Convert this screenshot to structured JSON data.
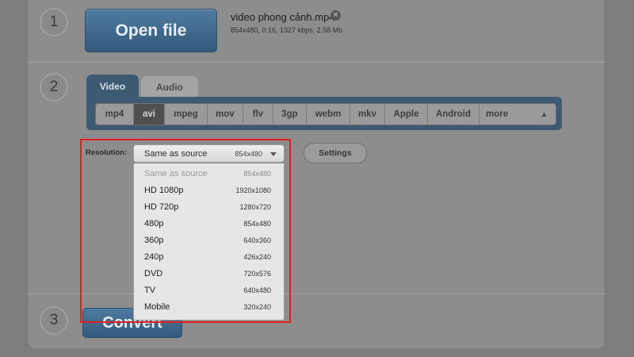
{
  "steps": {
    "one": "1",
    "two": "2",
    "three": "3"
  },
  "open_file": {
    "label": "Open file"
  },
  "file": {
    "name": "video phong cảnh.mp4",
    "meta": "854x480, 0:16, 1327 kbps, 2.58 Mb",
    "remove_icon": "close-circle-icon"
  },
  "tabs": {
    "video": "Video",
    "audio": "Audio"
  },
  "formats": [
    "mp4",
    "avi",
    "mpeg",
    "mov",
    "flv",
    "3gp",
    "webm",
    "mkv",
    "Apple",
    "Android",
    "more"
  ],
  "selected_format": "avi",
  "resolution": {
    "label": "Resolution:",
    "selected_label": "Same as source",
    "selected_value": "854x480",
    "options": [
      {
        "label": "Same as source",
        "value": "854x480"
      },
      {
        "label": "HD 1080p",
        "value": "1920x1080"
      },
      {
        "label": "HD 720p",
        "value": "1280x720"
      },
      {
        "label": "480p",
        "value": "854x480"
      },
      {
        "label": "360p",
        "value": "640x360"
      },
      {
        "label": "240p",
        "value": "426x240"
      },
      {
        "label": "DVD",
        "value": "720x576"
      },
      {
        "label": "TV",
        "value": "640x480"
      },
      {
        "label": "Mobile",
        "value": "320x240"
      }
    ]
  },
  "settings": {
    "label": "Settings"
  },
  "convert": {
    "label": "Convert"
  },
  "colors": {
    "accent": "#3e5a73",
    "highlight_border": "#e02020"
  }
}
